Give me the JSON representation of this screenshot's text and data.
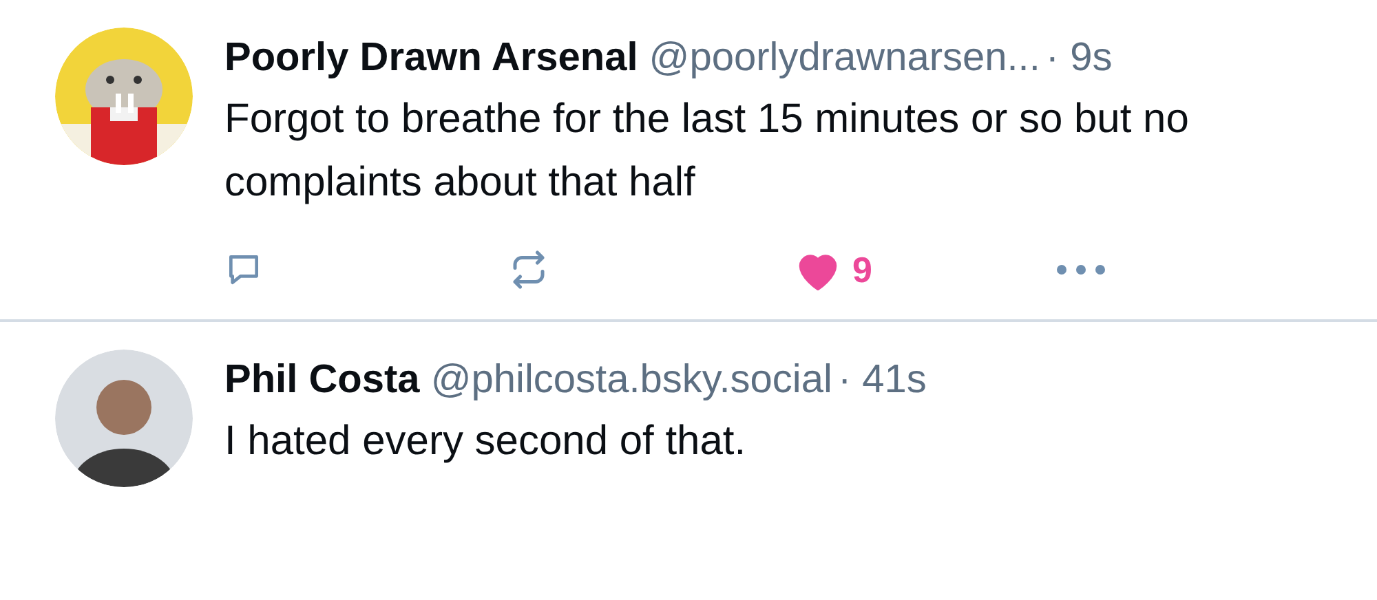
{
  "posts": [
    {
      "author": "Poorly Drawn Arsenal",
      "handle": "@poorlydrawnarsen...",
      "time": "· 9s",
      "text": "Forgot to breathe for the last 15 minutes or so but no complaints about that half",
      "actions": {
        "liked": true,
        "like_count": "9"
      }
    },
    {
      "avatar": {
        "kind": "person"
      },
      "author": "Phil Costa",
      "handle": "@philcosta.bsky.social",
      "time": "· 41s",
      "text": "I hated every second of that."
    }
  ]
}
